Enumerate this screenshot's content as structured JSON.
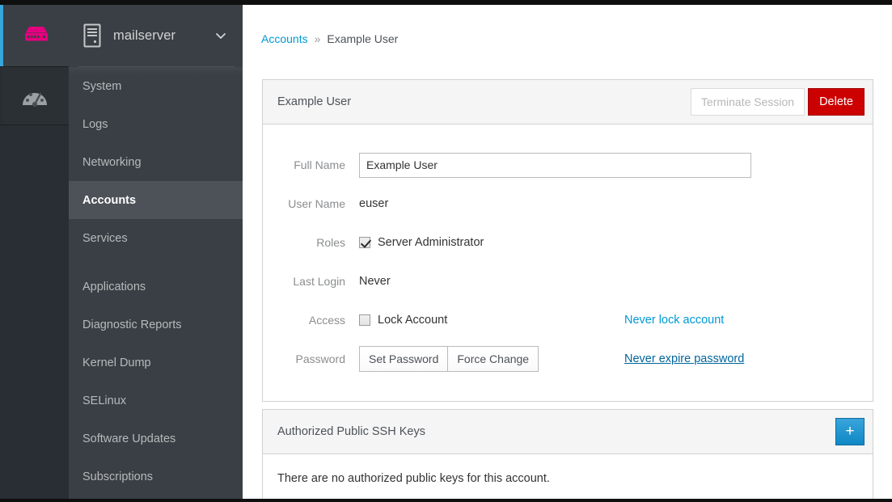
{
  "sidebar": {
    "brand_icon": "server-rack-icon",
    "host": {
      "name": "mailserver",
      "icon": "server-tower-icon",
      "caret": "chevron-down-icon"
    },
    "rail": [
      {
        "name": "dashboard",
        "icon": "dashboard-gauge-icon",
        "active": true
      }
    ],
    "nav_groups": [
      {
        "items": [
          {
            "label": "System",
            "active": false
          },
          {
            "label": "Logs",
            "active": false
          },
          {
            "label": "Networking",
            "active": false
          },
          {
            "label": "Accounts",
            "active": true
          },
          {
            "label": "Services",
            "active": false
          }
        ]
      },
      {
        "items": [
          {
            "label": "Applications",
            "active": false
          },
          {
            "label": "Diagnostic Reports",
            "active": false
          },
          {
            "label": "Kernel Dump",
            "active": false
          },
          {
            "label": "SELinux",
            "active": false
          },
          {
            "label": "Software Updates",
            "active": false
          },
          {
            "label": "Subscriptions",
            "active": false
          }
        ]
      }
    ]
  },
  "breadcrumb": {
    "parent": "Accounts",
    "separator": "»",
    "current": "Example User"
  },
  "account_card": {
    "title": "Example User",
    "terminate_label": "Terminate Session",
    "delete_label": "Delete",
    "fields": {
      "full_name_label": "Full Name",
      "full_name_value": "Example User",
      "user_name_label": "User Name",
      "user_name_value": "euser",
      "roles_label": "Roles",
      "roles_checkbox_label": "Server Administrator",
      "last_login_label": "Last Login",
      "last_login_value": "Never",
      "access_label": "Access",
      "lock_checkbox_label": "Lock Account",
      "never_lock_link": "Never lock account",
      "password_label": "Password",
      "set_password_label": "Set Password",
      "force_change_label": "Force Change",
      "never_expire_link": "Never expire password"
    }
  },
  "ssh_card": {
    "title": "Authorized Public SSH Keys",
    "add_label": "+",
    "empty_message": "There are no authorized public keys for this account."
  },
  "colors": {
    "sidebar_bg": "#393f44",
    "rail_bg": "#292e34",
    "nav_active_bg": "#4d5258",
    "accent_blue": "#39a5dc",
    "link_blue": "#0099d3",
    "link_hover_blue": "#00659c",
    "danger_red": "#cc0000",
    "brand_magenta": "#e4007f"
  }
}
